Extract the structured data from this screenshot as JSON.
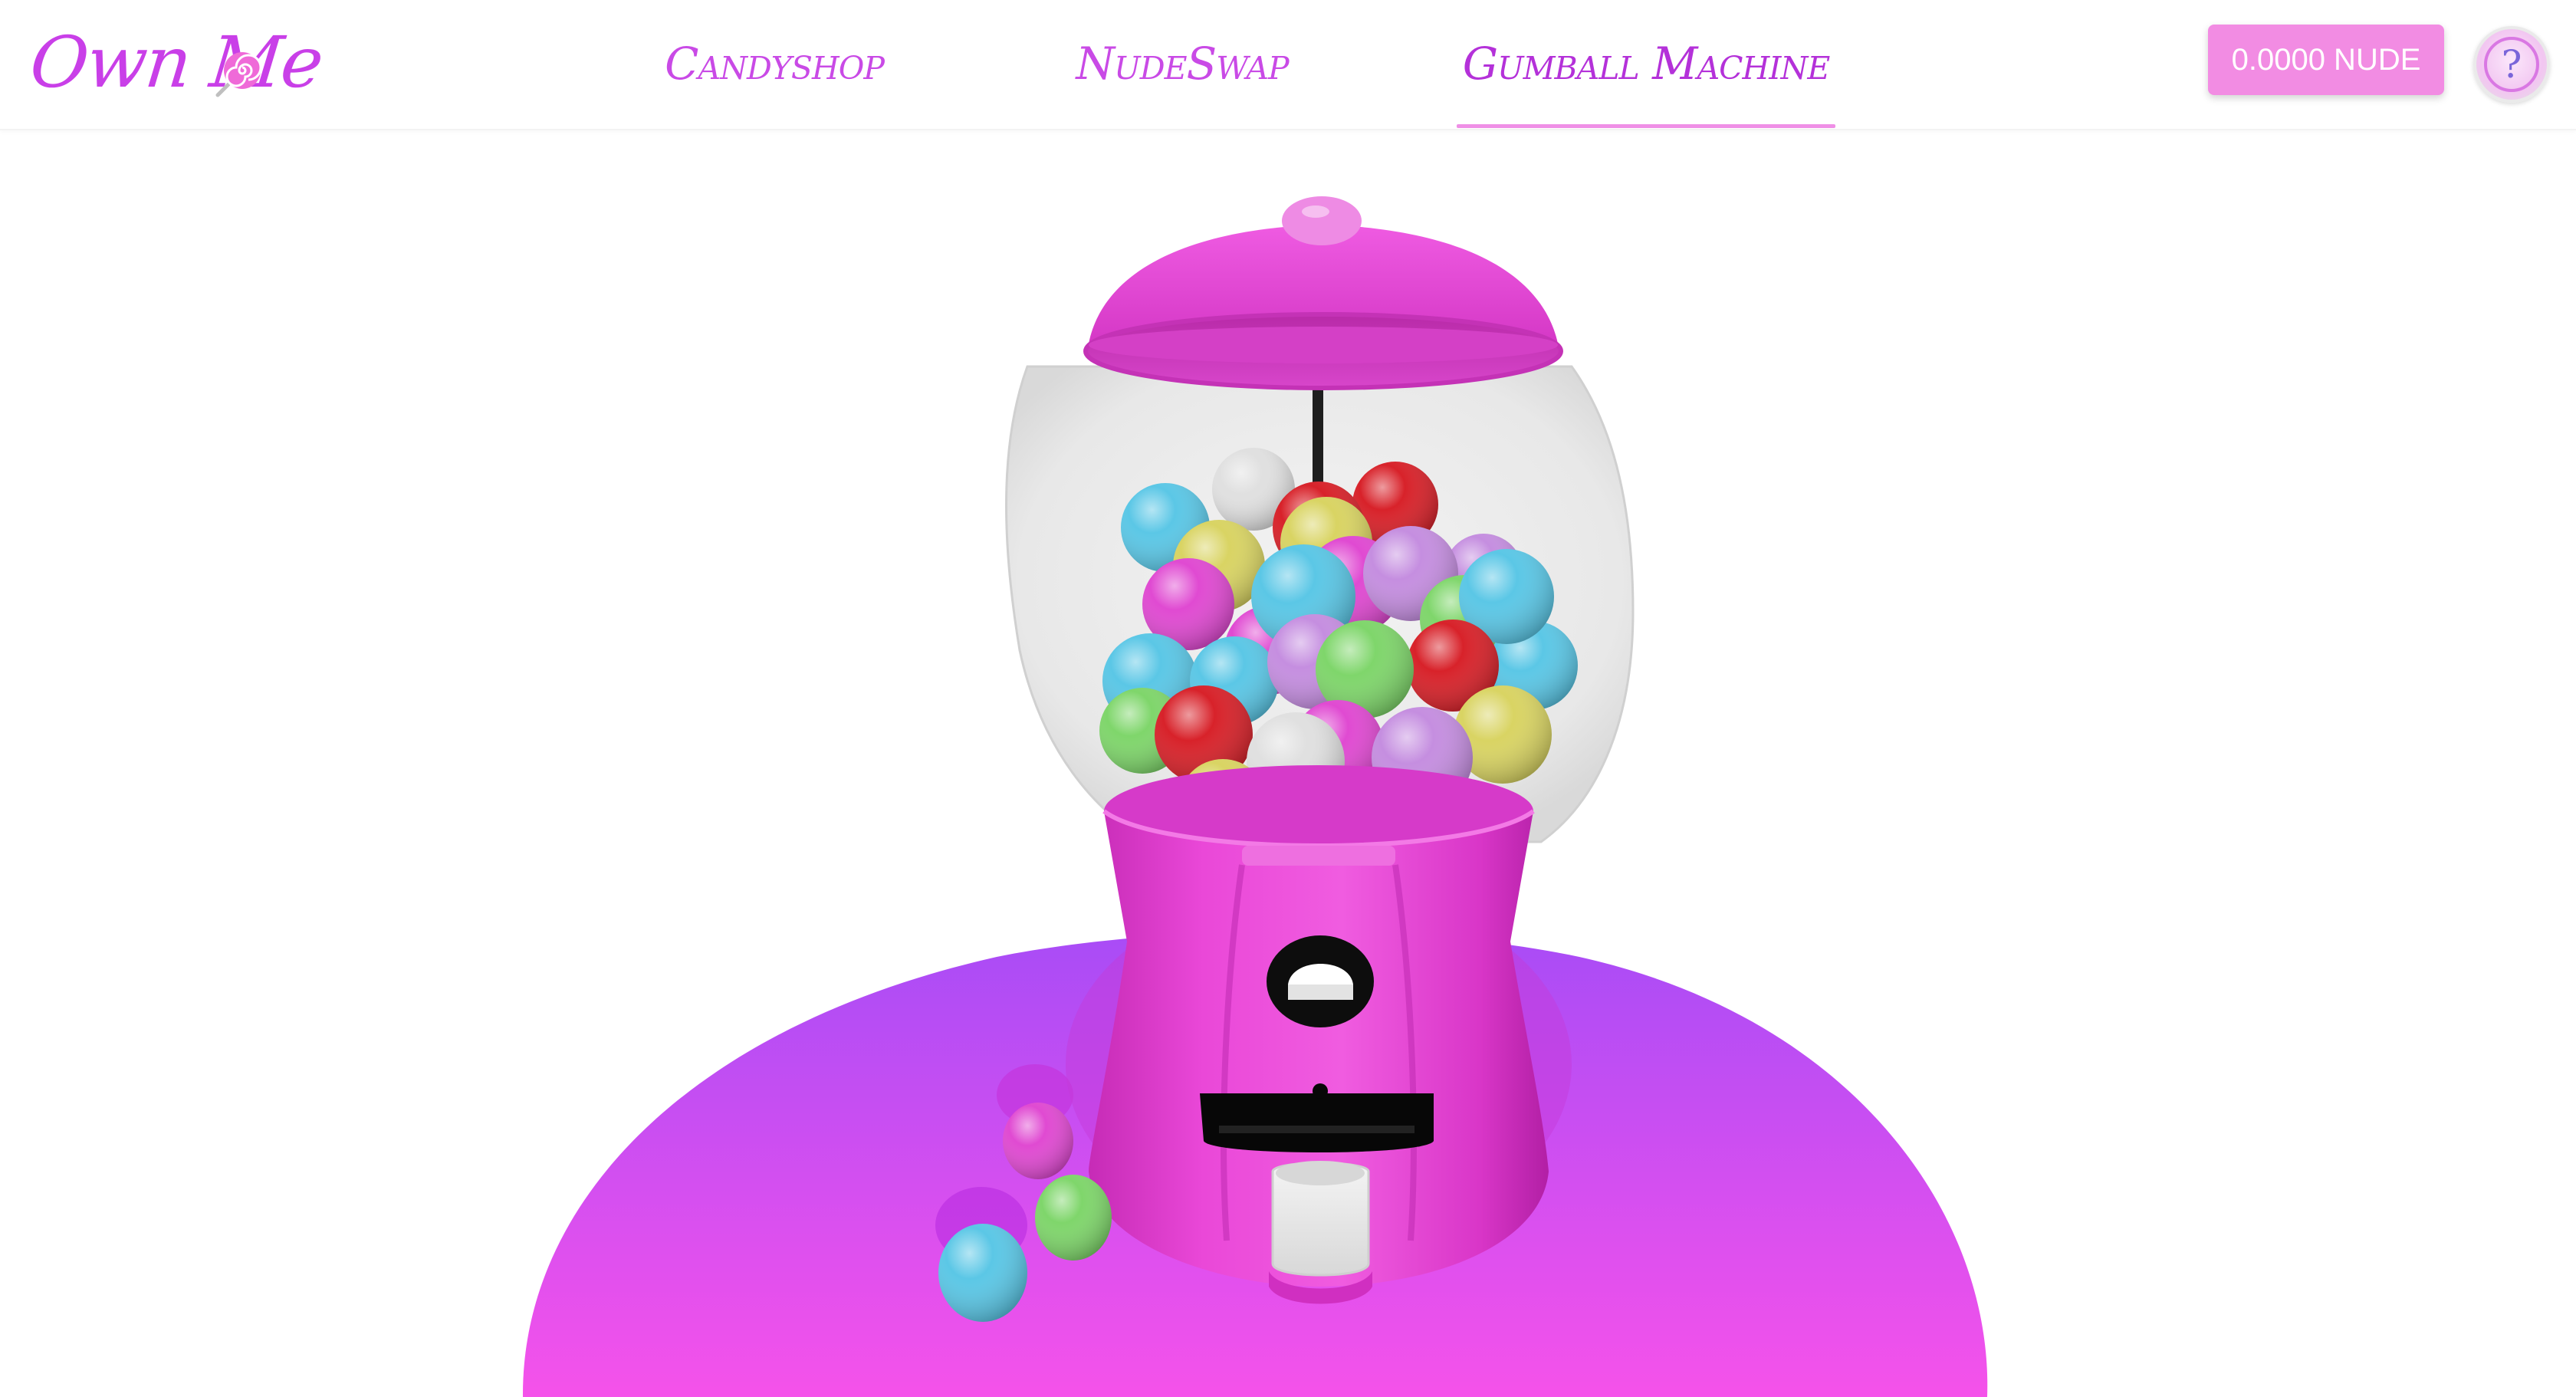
{
  "app": {
    "logo_text": "Own Me"
  },
  "nav": {
    "tabs": [
      {
        "label": "Candyshop",
        "active": false
      },
      {
        "label": "NudeSwap",
        "active": false
      },
      {
        "label": "Gumball Machine",
        "active": true
      }
    ]
  },
  "wallet": {
    "balance_label": "0.0000 NUDE"
  },
  "help": {
    "icon": "question-mark-icon",
    "label": "?"
  },
  "theme": {
    "accent": "#f28ce3",
    "machine_pink": "#e23fd0",
    "platform_purple": "#b04df5",
    "platform_magenta": "#f44fe7"
  },
  "scene": {
    "object": "gumball-machine",
    "gumball_colors": [
      "#e04ad2",
      "#5bc7e6",
      "#d9d463",
      "#7fd66b",
      "#d8222a",
      "#c58ee0",
      "#e0e0e0"
    ]
  }
}
